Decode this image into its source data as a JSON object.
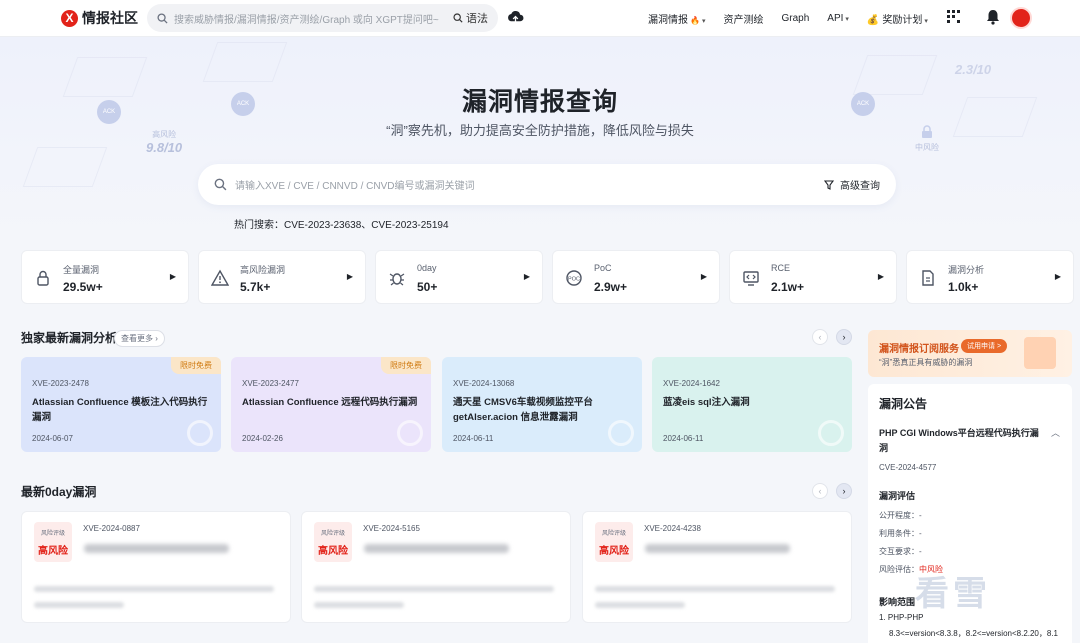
{
  "header": {
    "logo_mark": "X",
    "logo_text": "情报社区",
    "search_placeholder": "搜索威胁情报/漏洞情报/资产测绘/Graph 或向 XGPT提问吧~",
    "syntax_label": "语法",
    "nav": [
      {
        "label": "漏洞情报",
        "badge": "🔥",
        "caret": "▾"
      },
      {
        "label": "资产测绘"
      },
      {
        "label": "Graph"
      },
      {
        "label": "API",
        "caret": "▾"
      },
      {
        "label": "奖励计划",
        "prefix": "💰",
        "caret": "▾"
      }
    ],
    "colors": {
      "brand": "#e2231a"
    }
  },
  "hero": {
    "title": "漏洞情报查询",
    "subtitle": "“洞”察先机，助力提高安全防护措施，降低风险与损失",
    "search_placeholder": "请输入XVE / CVE / CNNVD / CNVD编号或漏洞关键词",
    "advanced_label": "高级查询",
    "hot_search": "热门搜索：CVE-2023-23638、CVE-2023-25194",
    "decor": {
      "high_risk_label": "高风险",
      "high_risk_score": "9.8/10",
      "mid_risk_label": "中风险",
      "badge_text": "ACK",
      "score_faded": "2.3/10"
    }
  },
  "stats": [
    {
      "label": "全量漏洞",
      "value": "29.5w+",
      "icon": "lock-icon"
    },
    {
      "label": "高风险漏洞",
      "value": "5.7k+",
      "icon": "warning-icon"
    },
    {
      "label": "0day",
      "value": "50+",
      "icon": "bug-icon"
    },
    {
      "label": "PoC",
      "value": "2.9w+",
      "icon": "poc-icon"
    },
    {
      "label": "RCE",
      "value": "2.1w+",
      "icon": "code-icon"
    },
    {
      "label": "漏洞分析",
      "value": "1.0k+",
      "icon": "document-icon"
    }
  ],
  "analysis": {
    "title": "独家最新漏洞分析",
    "more_label": "查看更多 ›",
    "cards": [
      {
        "id": "XVE-2023-2478",
        "title": "Atlassian Confluence 模板注入代码执行漏洞",
        "date": "2024-06-07",
        "tag": "限时免费",
        "bg": "#dbe4fb"
      },
      {
        "id": "XVE-2023-2477",
        "title": "Atlassian Confluence 远程代码执行漏洞",
        "date": "2024-02-26",
        "tag": "限时免费",
        "bg": "#ebe4fb"
      },
      {
        "id": "XVE-2024-13068",
        "title": "通天星 CMSV6车载视频监控平台 getAlser.acion 信息泄露漏洞",
        "date": "2024-06-11",
        "bg": "#daecfb"
      },
      {
        "id": "XVE-2024-1642",
        "title": "蓝凌eis sql注入漏洞",
        "date": "2024-06-11",
        "bg": "#d9f2ee"
      }
    ]
  },
  "zeroday": {
    "title": "最新0day漏洞",
    "cards": [
      {
        "risk_label": "风险评级",
        "risk": "高风险",
        "id": "XVE-2024-0887"
      },
      {
        "risk_label": "风险评级",
        "risk": "高风险",
        "id": "XVE-2024-5165"
      },
      {
        "risk_label": "风险评级",
        "risk": "高风险",
        "id": "XVE-2024-4238"
      }
    ]
  },
  "sidebar": {
    "banner_title": "漏洞情报订阅服务",
    "banner_button": "试用申请 >",
    "banner_desc": "“洞”悉真正具有威胁的漏洞",
    "notice_title": "漏洞公告",
    "vuln_title": "PHP CGI Windows平台远程代码执行漏洞",
    "vuln_id": "CVE-2024-4577",
    "eval_title": "漏洞评估",
    "eval": [
      {
        "k": "公开程度：",
        "v": "-"
      },
      {
        "k": "利用条件：",
        "v": "-"
      },
      {
        "k": "交互要求：",
        "v": "-"
      },
      {
        "k": "风险评估：",
        "v": "中风险"
      }
    ],
    "range_title": "影响范围",
    "range_item": "1. PHP-PHP",
    "range_detail": "8.3<=version<8.3.8，8.2<=version<8.2.20，8.1",
    "watermark": "看雪"
  }
}
